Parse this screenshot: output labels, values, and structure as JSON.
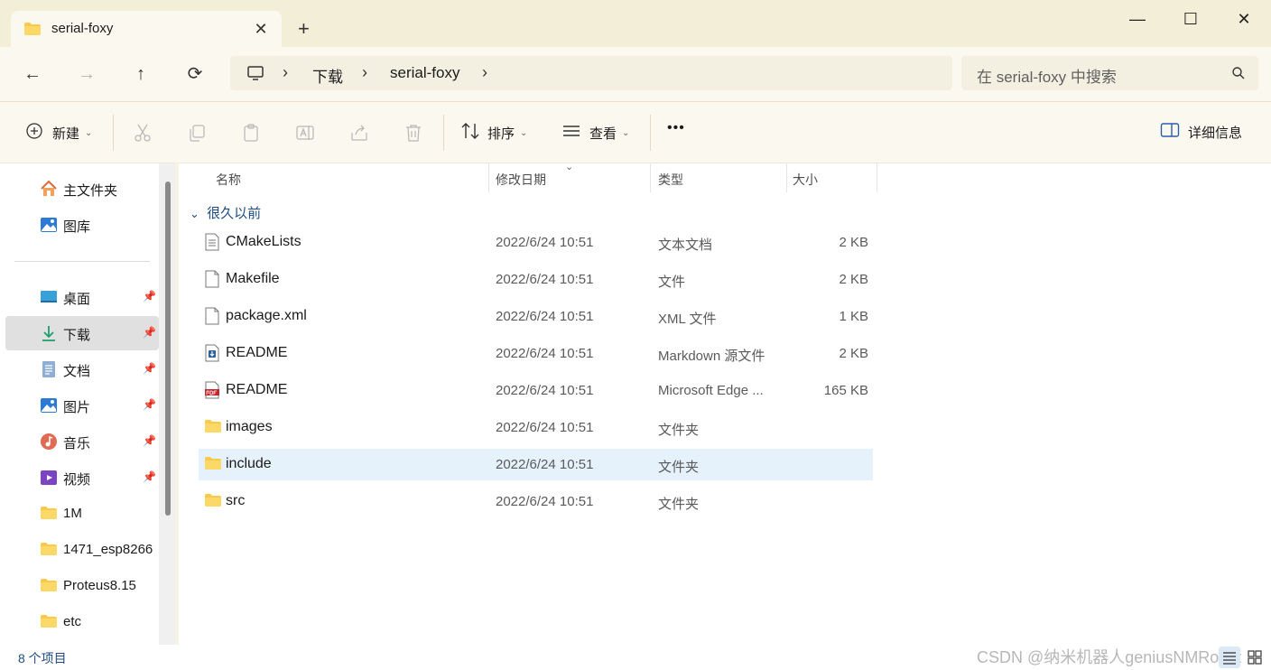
{
  "window": {
    "tab_title": "serial-foxy",
    "new_tab": "+",
    "minimize": "—",
    "maximize": "☐",
    "close": "✕"
  },
  "nav": {
    "back": "←",
    "forward": "→",
    "up": "↑",
    "refresh": "⟳",
    "breadcrumbs": [
      "下载",
      "serial-foxy"
    ],
    "search_placeholder": "在 serial-foxy 中搜索"
  },
  "toolbar": {
    "new_label": "新建",
    "sort_label": "排序",
    "view_label": "查看",
    "more_label": "•••",
    "details_label": "详细信息"
  },
  "sidebar": {
    "items": [
      {
        "label": "主文件夹",
        "icon": "home-icon"
      },
      {
        "label": "图库",
        "icon": "gallery-icon"
      },
      {
        "label": "桌面",
        "icon": "desktop-icon",
        "pinned": true
      },
      {
        "label": "下载",
        "icon": "download-icon",
        "pinned": true,
        "selected": true
      },
      {
        "label": "文档",
        "icon": "document-icon",
        "pinned": true
      },
      {
        "label": "图片",
        "icon": "pictures-icon",
        "pinned": true
      },
      {
        "label": "音乐",
        "icon": "music-icon",
        "pinned": true
      },
      {
        "label": "视频",
        "icon": "video-icon",
        "pinned": true
      },
      {
        "label": "1M",
        "icon": "folder-icon"
      },
      {
        "label": "1471_esp8266",
        "icon": "folder-icon"
      },
      {
        "label": "Proteus8.15",
        "icon": "folder-icon"
      },
      {
        "label": "etc",
        "icon": "folder-icon"
      }
    ]
  },
  "columns": {
    "name": "名称",
    "date": "修改日期",
    "type": "类型",
    "size": "大小"
  },
  "group_label": "很久以前",
  "files": [
    {
      "name": "CMakeLists",
      "date": "2022/6/24 10:51",
      "type": "文本文档",
      "size": "2 KB",
      "icon": "text-file-icon"
    },
    {
      "name": "Makefile",
      "date": "2022/6/24 10:51",
      "type": "文件",
      "size": "2 KB",
      "icon": "file-icon"
    },
    {
      "name": "package.xml",
      "date": "2022/6/24 10:51",
      "type": "XML 文件",
      "size": "1 KB",
      "icon": "file-icon"
    },
    {
      "name": "README",
      "date": "2022/6/24 10:51",
      "type": "Markdown 源文件",
      "size": "2 KB",
      "icon": "markdown-file-icon"
    },
    {
      "name": "README",
      "date": "2022/6/24 10:51",
      "type": "Microsoft Edge ...",
      "size": "165 KB",
      "icon": "pdf-file-icon"
    },
    {
      "name": "images",
      "date": "2022/6/24 10:51",
      "type": "文件夹",
      "size": "",
      "icon": "folder-icon"
    },
    {
      "name": "include",
      "date": "2022/6/24 10:51",
      "type": "文件夹",
      "size": "",
      "icon": "folder-icon",
      "selected": true
    },
    {
      "name": "src",
      "date": "2022/6/24 10:51",
      "type": "文件夹",
      "size": "",
      "icon": "folder-icon"
    }
  ],
  "status": {
    "item_count": "8 个项目"
  },
  "watermark": "CSDN @纳米机器人geniusNMRobot",
  "colors": {
    "accent_folder": "#f8c94a",
    "selection": "#e5f1fb",
    "link_blue": "#1d4b85"
  }
}
